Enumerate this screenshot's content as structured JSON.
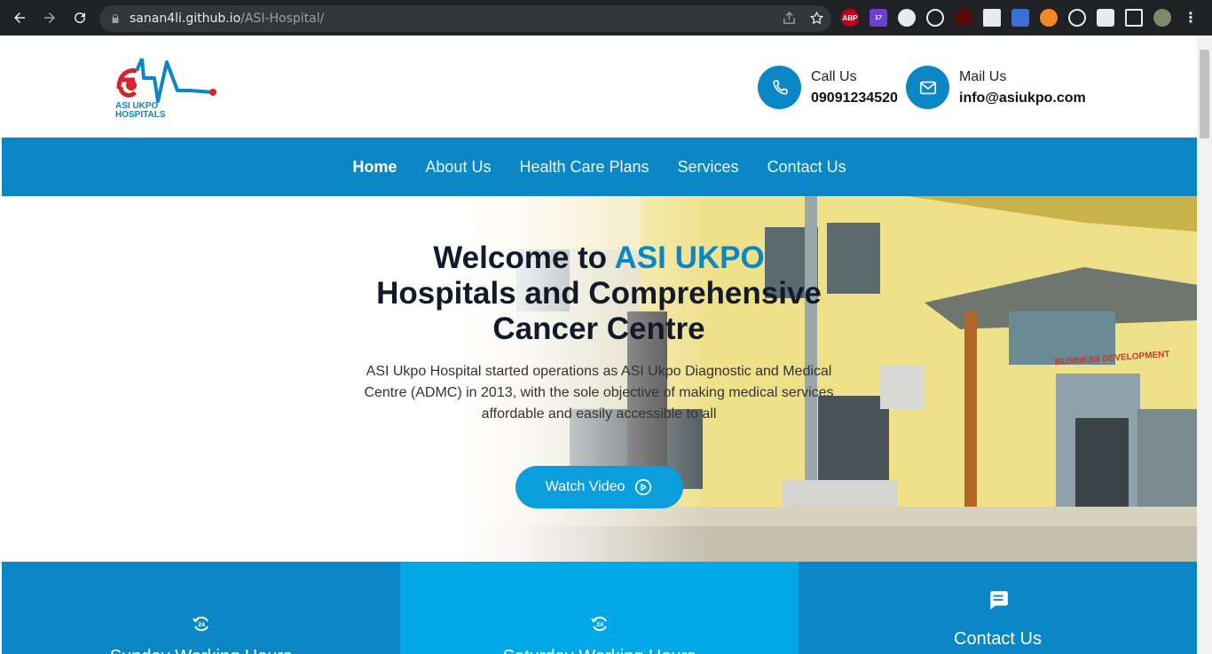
{
  "browser": {
    "url_host": "sanan4li.github.io",
    "url_path": "/ASI-Hospital/",
    "extensions": [
      "ABP",
      "17"
    ]
  },
  "header": {
    "logo_text": "ASI UKPO HOSPITALS",
    "call_label": "Call Us",
    "call_value": "09091234520",
    "mail_label": "Mail Us",
    "mail_value": "info@asiukpo.com"
  },
  "nav": {
    "items": [
      "Home",
      "About Us",
      "Health Care Plans",
      "Services",
      "Contact Us"
    ],
    "active": "Home"
  },
  "hero": {
    "title_prefix": "Welcome to ",
    "title_brand": "ASI UKPO",
    "title_rest": "Hospitals and Comprehensive Cancer Centre",
    "description": "ASI Ukpo Hospital started operations as ASI Ukpo Diagnostic and Medical Centre (ADMC) in 2013, with the sole objective of making medical services affordable and easily accessible to all",
    "button_label": "Watch Video",
    "sign_text": "BUSINESS DEVELOPMENT"
  },
  "cards": [
    {
      "icon": "24-hours-icon",
      "title": "Sunday Working Hours"
    },
    {
      "icon": "24-hours-icon",
      "title": "Saturday Working Hours"
    },
    {
      "icon": "chat-icon",
      "title": "Contact Us"
    }
  ],
  "colors": {
    "primary": "#0a87c4",
    "accent": "#00a8e8",
    "dark": "#111a2b"
  }
}
